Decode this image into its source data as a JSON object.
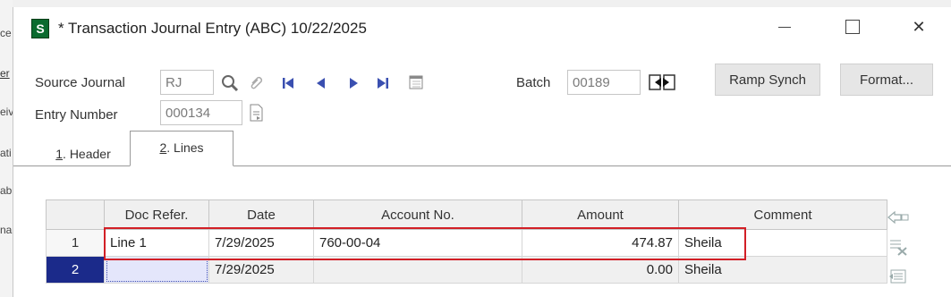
{
  "background_app": {
    "fragments": [
      "ce",
      "er",
      "eiv",
      "ati",
      "ab",
      "na"
    ]
  },
  "window": {
    "title": "* Transaction Journal Entry (ABC) 10/22/2025",
    "app_icon_letter": "S",
    "minimize_glyph": "",
    "close_glyph": "✕"
  },
  "form": {
    "source_journal_label": "Source Journal",
    "source_journal_value": "RJ",
    "entry_number_label": "Entry Number",
    "entry_number_value": "000134",
    "batch_label": "Batch",
    "batch_value": "00189",
    "ramp_synch_label": "Ramp Synch",
    "format_label": "Format..."
  },
  "tabs": [
    {
      "accel": "1",
      "label": ". Header",
      "active": false
    },
    {
      "accel": "2",
      "label": ". Lines",
      "active": true
    }
  ],
  "grid": {
    "columns": [
      "",
      "Doc Refer.",
      "Date",
      "Account No.",
      "Amount",
      "Comment"
    ],
    "rows": [
      {
        "num": "1",
        "doc_ref": "Line 1",
        "date": "7/29/2025",
        "account": "760-00-04",
        "amount": "474.87",
        "comment": "Sheila"
      },
      {
        "num": "2",
        "doc_ref": "",
        "date": "7/29/2025",
        "account": "",
        "amount": "0.00",
        "comment": "Sheila"
      }
    ]
  },
  "colors": {
    "accent_selected_row": "#1b2a8a",
    "highlight_border": "#d21f26",
    "app_icon_green": "#0a6b2f"
  },
  "icons": {
    "lookup": "magnifier-icon",
    "attach": "paperclip-icon",
    "first": "first-record-icon",
    "prev": "previous-record-icon",
    "next": "next-record-icon",
    "last": "last-record-icon",
    "calendar": "calendar-icon",
    "next_number": "next-number-icon",
    "batch": "batch-selector-icon",
    "insert_row": "insert-row-icon",
    "delete_row": "delete-row-icon",
    "row_options": "row-options-icon"
  }
}
